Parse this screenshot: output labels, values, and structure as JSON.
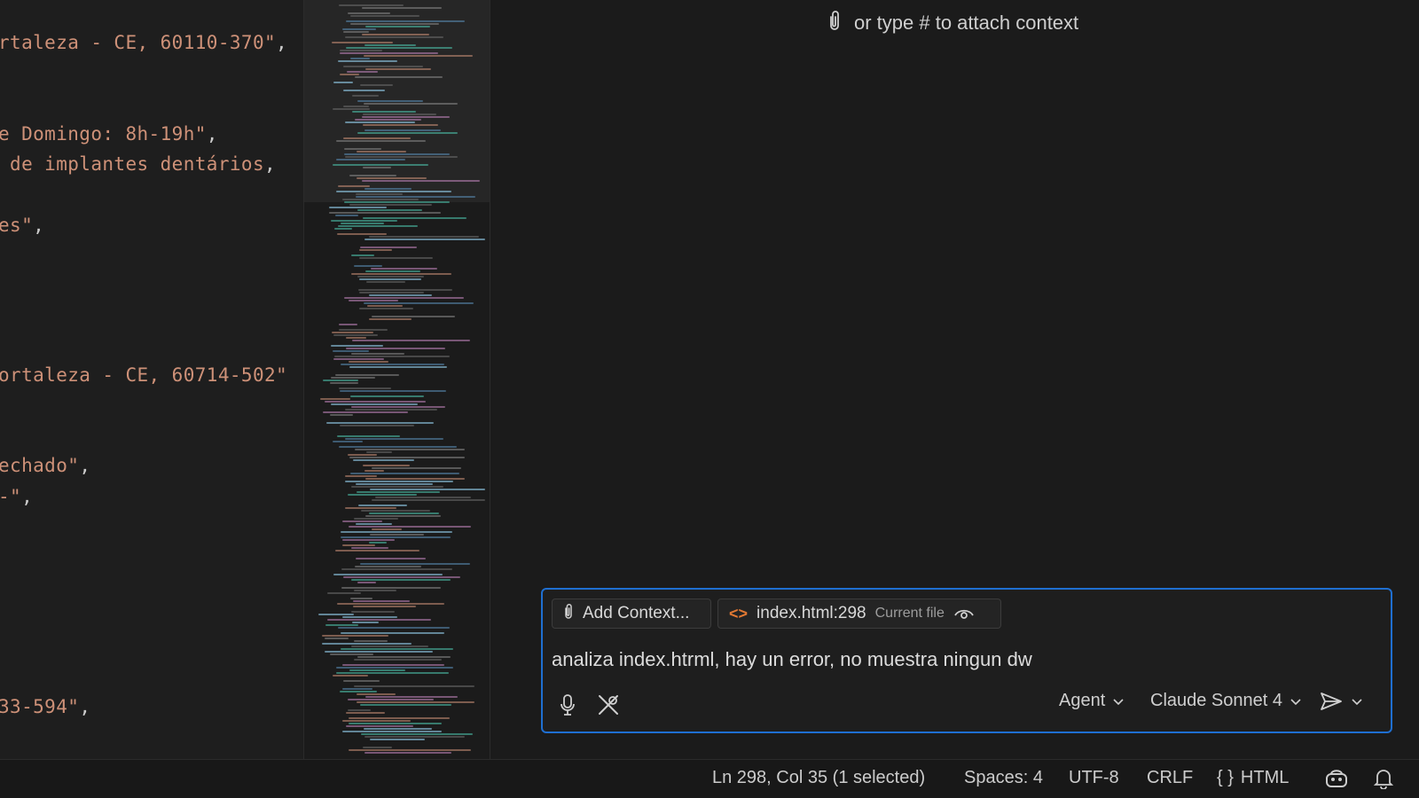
{
  "editor": {
    "lines": [
      {
        "text": "rtaleza - CE, 60110-370\"",
        "punct": ","
      },
      {
        "text": "e Domingo: 8h-19h\"",
        "punct": ","
      },
      {
        "text": " de implantes dentários",
        "punct": ","
      },
      {
        "text": "es\"",
        "punct": ","
      },
      {
        "text": "ortaleza - CE, 60714-502\"",
        "punct": ""
      },
      {
        "text": "echado\"",
        "punct": ","
      },
      {
        "text": "-\"",
        "punct": ","
      },
      {
        "text": "33-594\"",
        "punct": ","
      }
    ]
  },
  "chat": {
    "attach_hint": "or type # to attach context",
    "add_context_label": "Add Context...",
    "file_chip": {
      "name": "index.html:298",
      "sub": "Current file"
    },
    "prompt": "analiza index.htrml, hay un error, no muestra ningun dw",
    "mode_label": "Agent",
    "model_label": "Claude Sonnet 4"
  },
  "statusbar": {
    "position": "Ln 298, Col 35 (1 selected)",
    "spaces": "Spaces: 4",
    "encoding": "UTF-8",
    "eol": "CRLF",
    "language": "HTML"
  },
  "colors": {
    "accent": "#1f6fd1",
    "string": "#ce9178",
    "file_icon": "#e37933"
  }
}
